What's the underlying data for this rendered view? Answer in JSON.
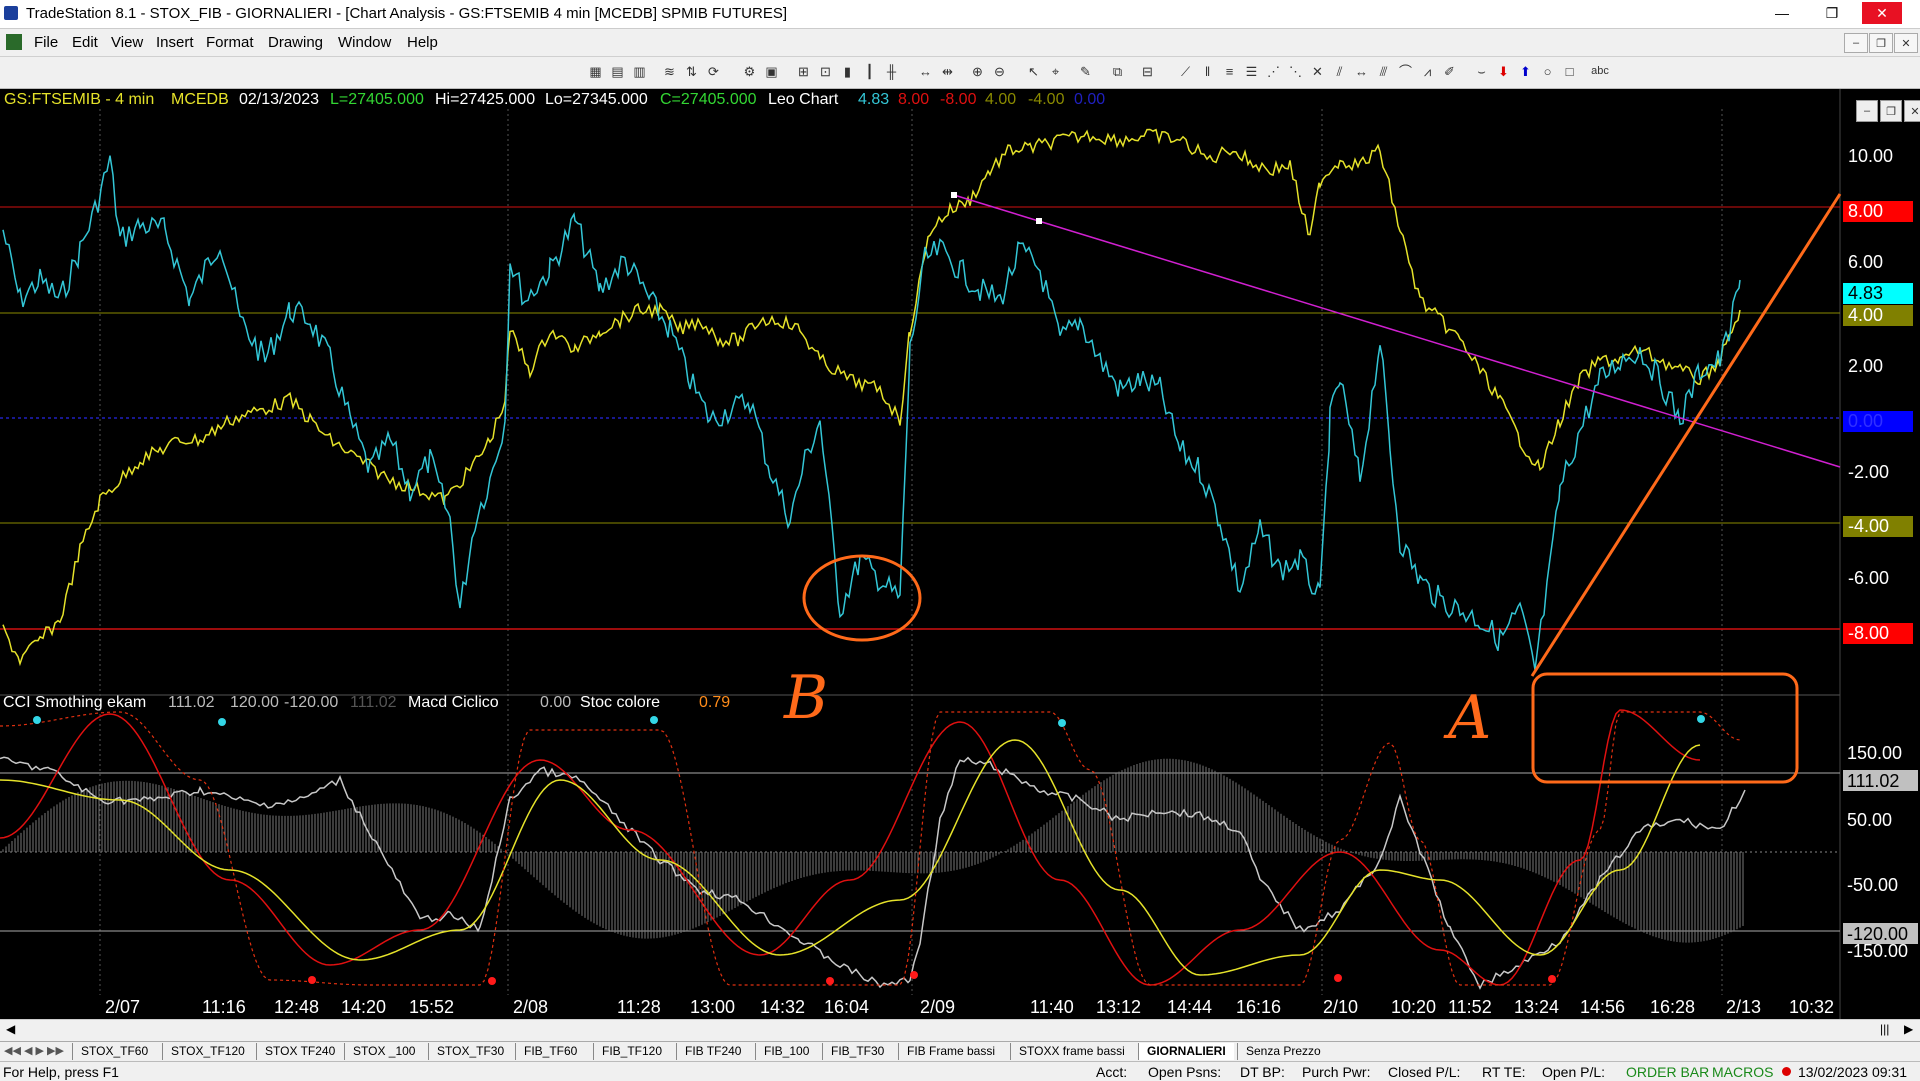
{
  "window": {
    "title": "TradeStation 8.1 - STOX_FIB - GIORNALIERI - [Chart Analysis - GS:FTSEMIB  4 min  [MCEDB] SPMIB FUTURES]",
    "minimize": "—",
    "maximize": "❐",
    "close": "✕"
  },
  "menu": [
    "File",
    "Edit",
    "View",
    "Insert",
    "Format",
    "Drawing",
    "Window",
    "Help"
  ],
  "mdi_controls": [
    "–",
    "❐",
    "✕"
  ],
  "chart_header": {
    "symbol": "GS:FTSEMIB - 4 min",
    "datafeed": "MCEDB",
    "date": "02/13/2023",
    "last": "L=27405.000",
    "high": "Hi=27425.000",
    "low": "Lo=27345.000",
    "close": "C=27405.000",
    "indicator_name": "Leo Chart",
    "v1": "4.83",
    "v2": "8.00",
    "v3": "-8.00",
    "v4": "4.00",
    "v5": "-4.00",
    "v6": "0.00"
  },
  "lower_header": {
    "cci_name": "CCI Smothing ekam",
    "cci_v1": "111.02",
    "cci_v2": "120.00",
    "cci_v3": "-120.00",
    "cci_v4": "111.02",
    "macd_name": "Macd Ciclico",
    "macd_v": "0.00",
    "stoc_name": "Stoc colore",
    "stoc_v": "0.79"
  },
  "upper_axis": [
    "10.00",
    "8.00",
    "6.00",
    "4.83",
    "4.00",
    "2.00",
    "0.00",
    "-2.00",
    "-4.00",
    "-6.00",
    "-8.00"
  ],
  "lower_axis": [
    "150.00",
    "111.02",
    "50.00",
    "-50.00",
    "-120.00",
    "-150.00"
  ],
  "time_axis": [
    "2/07",
    "11:16",
    "12:48",
    "14:20",
    "15:52",
    "2/08",
    "11:28",
    "13:00",
    "14:32",
    "16:04",
    "2/09",
    "11:40",
    "13:12",
    "14:44",
    "16:16",
    "2/10",
    "10:20",
    "11:52",
    "13:24",
    "14:56",
    "16:28",
    "2/13",
    "10:32"
  ],
  "annotations": {
    "b_label": "B",
    "a_label": "A"
  },
  "tabs": [
    "STOX_TF60",
    "STOX_TF120",
    "STOX TF240",
    "STOX _100",
    "STOX_TF30",
    "FIB_TF60",
    "FIB_TF120",
    "FIB TF240",
    "FIB_100",
    "FIB_TF30",
    "FIB Frame bassi",
    "STOXX frame bassi",
    "GIORNALIERI",
    "Senza Prezzo"
  ],
  "active_tab": "GIORNALIERI",
  "status": {
    "help": "For Help, press F1",
    "acct": "Acct:",
    "open_psns": "Open Psns:",
    "dt_bp": "DT BP:",
    "purch_pwr": "Purch Pwr:",
    "closed_pl": "Closed P/L:",
    "rt_te": "RT TE:",
    "open_pl": "Open P/L:",
    "order_bar": "ORDER BAR",
    "macros": "MACROS",
    "datetime": "13/02/2023 09:31"
  },
  "colors": {
    "cyan": "#33c6d6",
    "yellow": "#e5e22a",
    "red": "#e01010",
    "orange": "#ff6a1a",
    "magenta": "#d020d0",
    "bg": "#000000",
    "grid": "#808080"
  }
}
